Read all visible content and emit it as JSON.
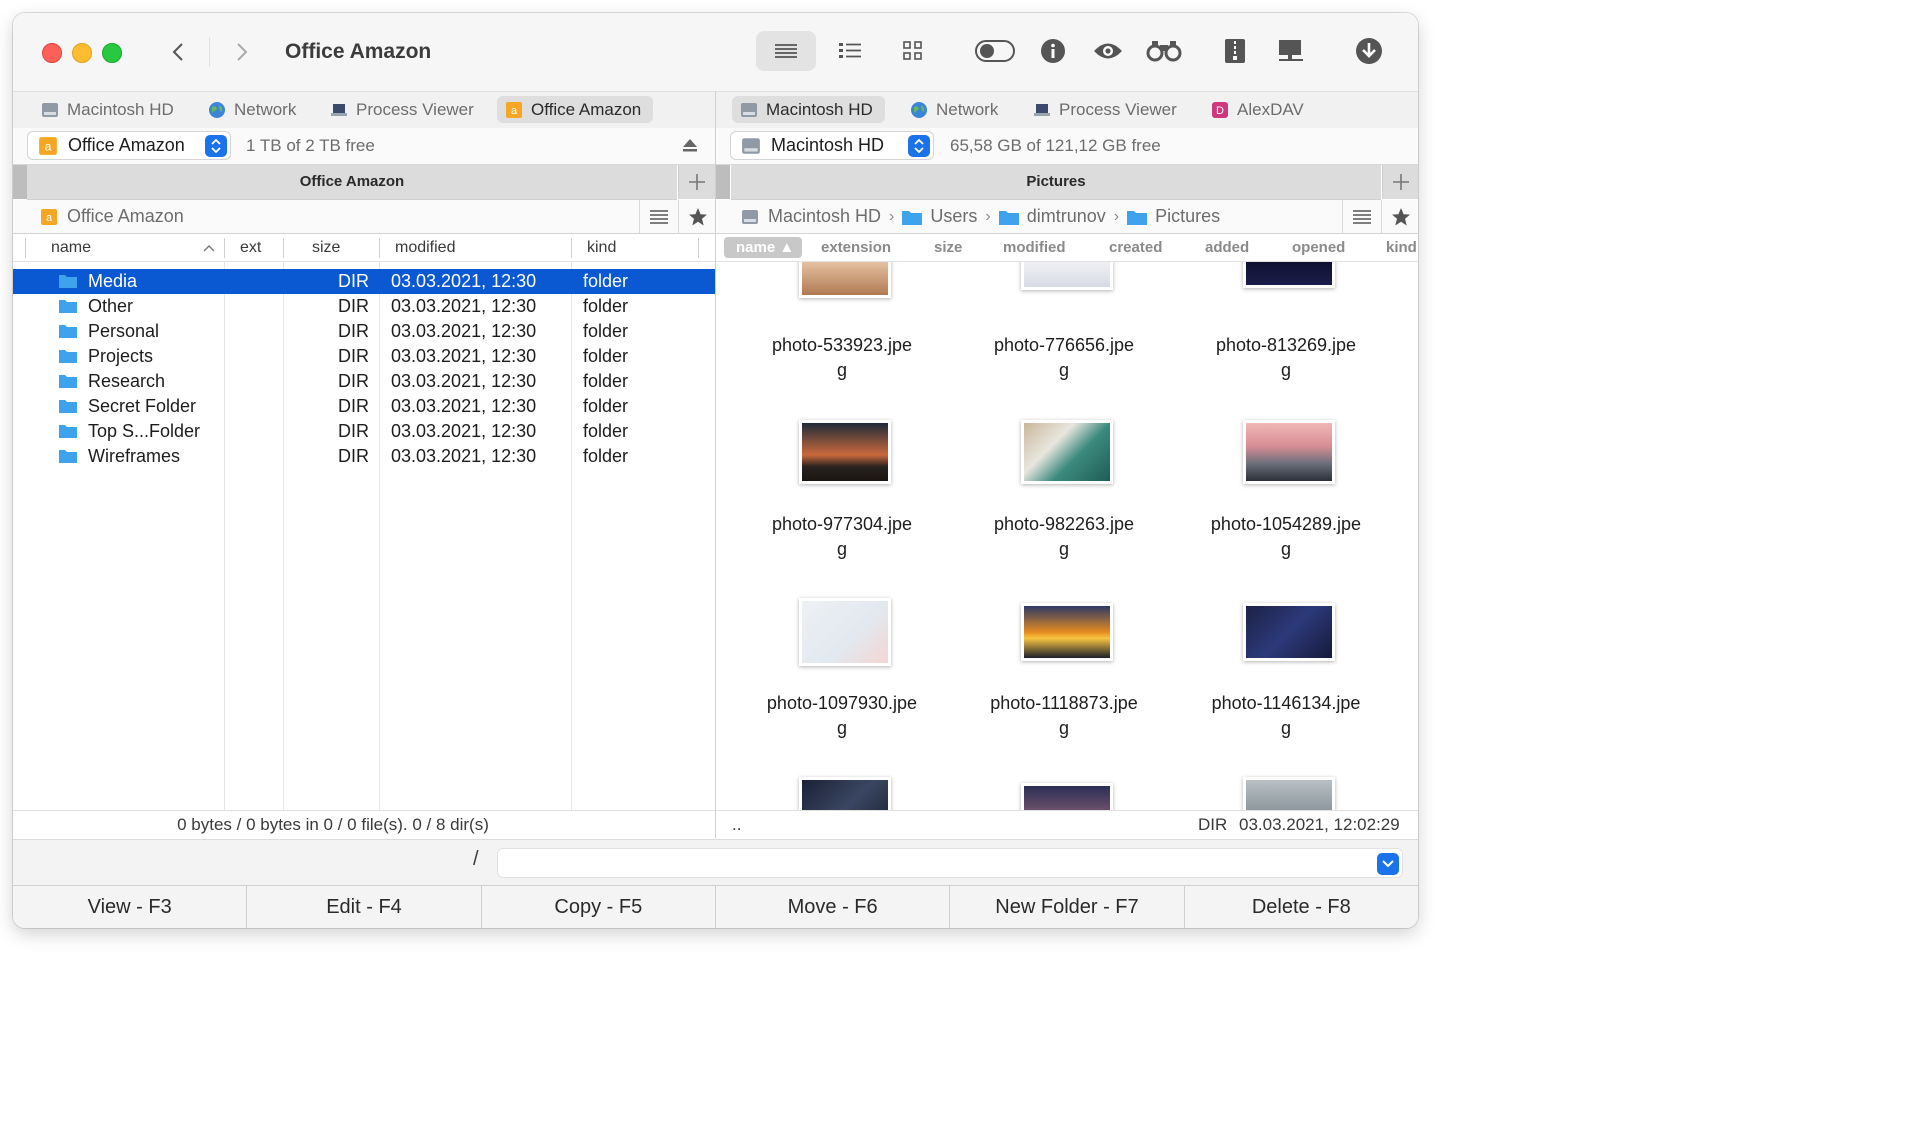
{
  "window": {
    "title": "Office Amazon"
  },
  "toolbar": {
    "icons": [
      "list-view-icon",
      "detail-list-icon",
      "grid-view-icon",
      "toggle-icon",
      "info-icon",
      "eye-icon",
      "binoculars-icon",
      "archive-icon",
      "computer-icon",
      "download-icon"
    ]
  },
  "left": {
    "tabs": [
      {
        "label": "Macintosh HD",
        "icon": "disk-icon"
      },
      {
        "label": "Network",
        "icon": "globe-icon"
      },
      {
        "label": "Process Viewer",
        "icon": "laptop-icon"
      },
      {
        "label": "Office Amazon",
        "icon": "amazon-icon"
      }
    ],
    "volume": "Office Amazon",
    "free": "1 TB of 2 TB free",
    "panel_title": "Office Amazon",
    "path": "Office Amazon",
    "columns": {
      "name": "name",
      "ext": "ext",
      "size": "size",
      "modified": "modified",
      "kind": "kind"
    },
    "rows": [
      {
        "name": "Media",
        "size": "DIR",
        "modified": "03.03.2021, 12:30",
        "kind": "folder"
      },
      {
        "name": "Other",
        "size": "DIR",
        "modified": "03.03.2021, 12:30",
        "kind": "folder"
      },
      {
        "name": "Personal",
        "size": "DIR",
        "modified": "03.03.2021, 12:30",
        "kind": "folder"
      },
      {
        "name": "Projects",
        "size": "DIR",
        "modified": "03.03.2021, 12:30",
        "kind": "folder"
      },
      {
        "name": "Research",
        "size": "DIR",
        "modified": "03.03.2021, 12:30",
        "kind": "folder"
      },
      {
        "name": "Secret Folder",
        "size": "DIR",
        "modified": "03.03.2021, 12:30",
        "kind": "folder"
      },
      {
        "name": "Top S...Folder",
        "size": "DIR",
        "modified": "03.03.2021, 12:30",
        "kind": "folder"
      },
      {
        "name": "Wireframes",
        "size": "DIR",
        "modified": "03.03.2021, 12:30",
        "kind": "folder"
      }
    ],
    "status": "0 bytes / 0 bytes in 0 / 0 file(s). 0 / 8 dir(s)"
  },
  "right": {
    "tabs": [
      {
        "label": "Macintosh HD",
        "icon": "disk-icon"
      },
      {
        "label": "Network",
        "icon": "globe-icon"
      },
      {
        "label": "Process Viewer",
        "icon": "laptop-icon"
      },
      {
        "label": "AlexDAV",
        "icon": "webdav-icon"
      }
    ],
    "volume": "Macintosh HD",
    "free": "65,58 GB of 121,12 GB free",
    "panel_title": "Pictures",
    "breadcrumb": [
      "Macintosh HD",
      "Users",
      "dimtrunov",
      "Pictures"
    ],
    "columns": [
      "name",
      "extension",
      "size",
      "modified",
      "created",
      "added",
      "opened",
      "kind"
    ],
    "thumbs": [
      {
        "line1": "photo-533923.jpe",
        "line2": "g"
      },
      {
        "line1": "photo-776656.jpe",
        "line2": "g"
      },
      {
        "line1": "photo-813269.jpe",
        "line2": "g"
      },
      {
        "line1": "photo-977304.jpe",
        "line2": "g"
      },
      {
        "line1": "photo-982263.jpe",
        "line2": "g"
      },
      {
        "line1": "photo-1054289.jpe",
        "line2": "g"
      },
      {
        "line1": "photo-1097930.jpe",
        "line2": "g"
      },
      {
        "line1": "photo-1118873.jpe",
        "line2": "g"
      },
      {
        "line1": "photo-1146134.jpe",
        "line2": "g"
      }
    ],
    "status_left": "..",
    "status_kind": "DIR",
    "status_date": "03.03.2021, 12:02:29"
  },
  "cmdline": {
    "prompt": "/",
    "value": ""
  },
  "fkeys": [
    "View - F3",
    "Edit - F4",
    "Copy - F5",
    "Move - F6",
    "New Folder - F7",
    "Delete - F8"
  ],
  "colors": {
    "selection": "#0a59d3",
    "accent": "#1a73e8"
  }
}
